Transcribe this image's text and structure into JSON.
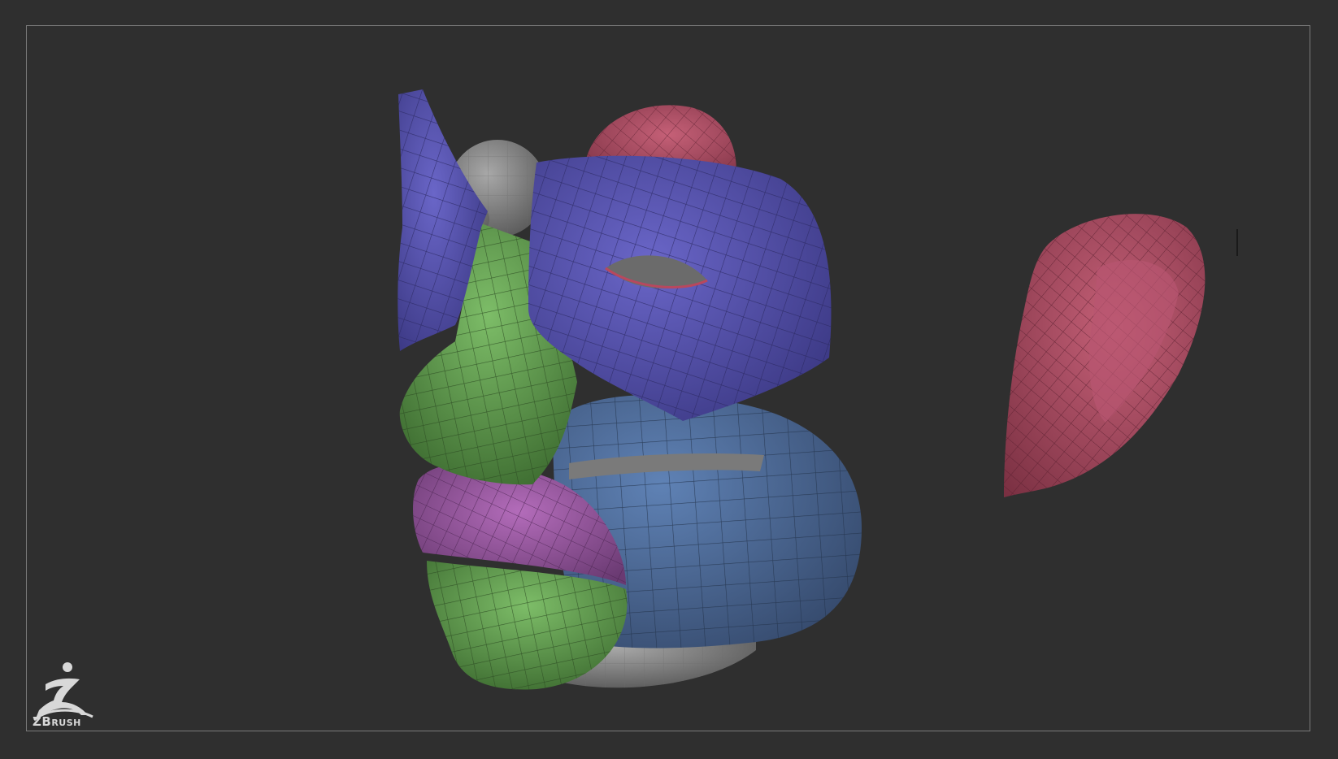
{
  "app": {
    "logo_text_first": "ZB",
    "logo_text_rest": "RUSH",
    "logo_icon": "zbrush-figure-icon"
  },
  "viewport": {
    "content": "polygroup-mesh-head-parts",
    "colors": {
      "background": "#2f2f2f",
      "frame": "#7a7a7a",
      "purple_group": "#5b57b5",
      "green_group": "#6da85a",
      "magenta_group": "#a05ca7",
      "blue_group": "#4c6c9a",
      "ear_group": "#a84a60",
      "base_gray": "#8a8a8a"
    }
  }
}
